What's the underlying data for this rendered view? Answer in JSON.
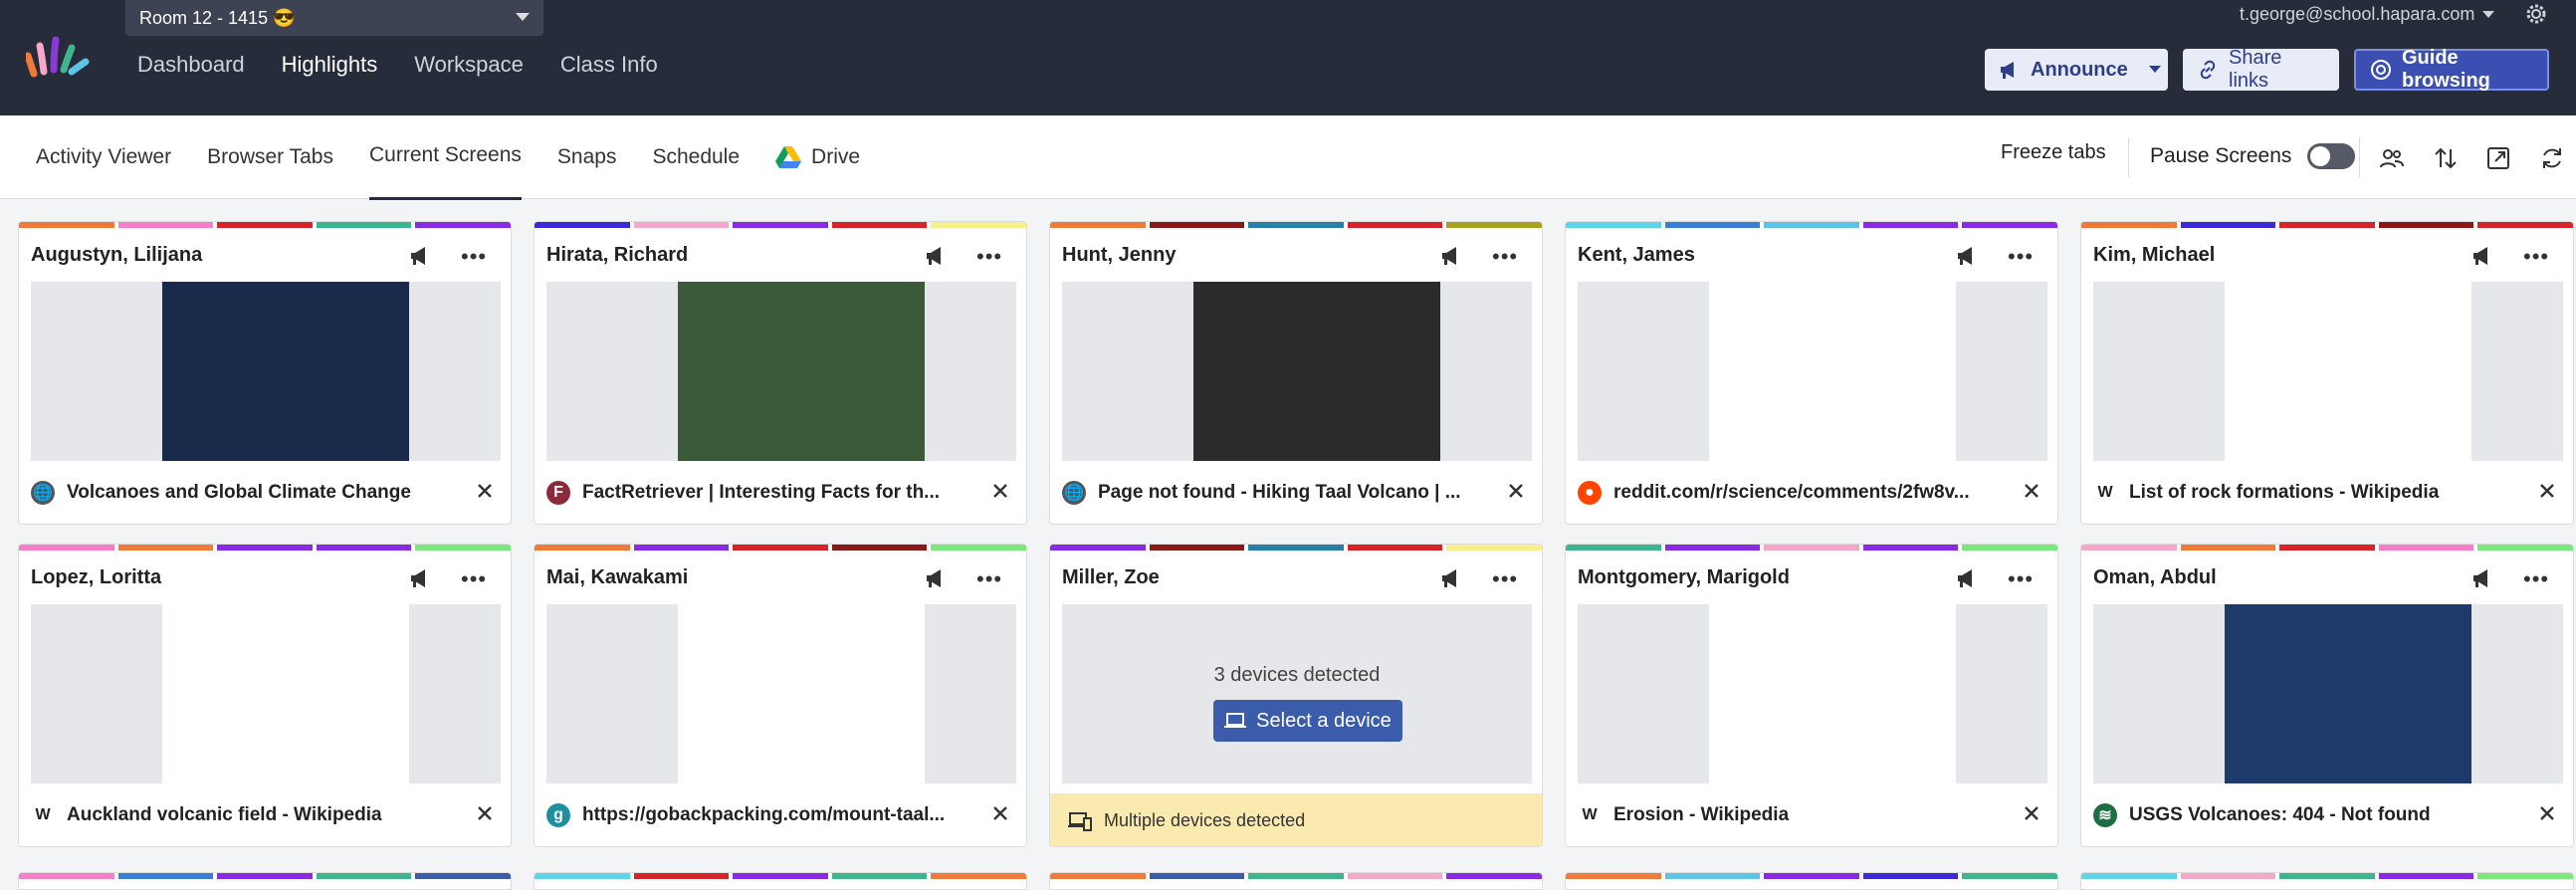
{
  "header": {
    "room": "Room 12 - 1415 😎",
    "nav": [
      "Dashboard",
      "Highlights",
      "Workspace",
      "Class Info"
    ],
    "active_nav": "Highlights",
    "account": "t.george@school.hapara.com",
    "buttons": {
      "announce": "Announce",
      "share": "Share links",
      "guide": "Guide browsing"
    }
  },
  "subtabs": {
    "items": [
      "Activity Viewer",
      "Browser Tabs",
      "Current Screens",
      "Snaps",
      "Schedule",
      "Drive"
    ],
    "active": "Current Screens",
    "freeze": "Freeze tabs",
    "pause": "Pause Screens"
  },
  "colors": {
    "accent": "#3b4fb3",
    "navbar": "#262c3a",
    "warning": "#fbeab0"
  },
  "students": [
    {
      "name": "Augustyn, Lilijana",
      "tab": "Volcanoes and Global Climate Change",
      "favicon": "globe-icon"
    },
    {
      "name": "Hirata, Richard",
      "tab": "FactRetriever | Interesting Facts for th...",
      "favicon": "factretriever-icon"
    },
    {
      "name": "Hunt, Jenny",
      "tab": "Page not found - Hiking Taal Volcano | ...",
      "favicon": "globe-icon"
    },
    {
      "name": "Kent, James",
      "tab": "reddit.com/r/science/comments/2fw8v...",
      "favicon": "reddit-icon"
    },
    {
      "name": "Kim, Michael",
      "tab": "List of rock formations - Wikipedia",
      "favicon": "wikipedia-icon"
    },
    {
      "name": "Lopez, Loritta",
      "tab": "Auckland volcanic field - Wikipedia",
      "favicon": "wikipedia-icon"
    },
    {
      "name": "Mai, Kawakami",
      "tab": "https://gobackpacking.com/mount-taal...",
      "favicon": "gobackpacking-icon"
    },
    {
      "name": "Miller, Zoe",
      "detected": "3 devices detected",
      "select": "Select a device",
      "multi": "Multiple devices detected"
    },
    {
      "name": "Montgomery, Marigold",
      "tab": "Erosion - Wikipedia",
      "favicon": "wikipedia-icon"
    },
    {
      "name": "Oman, Abdul",
      "tab": "USGS Volcanoes: 404 - Not found",
      "favicon": "usgs-icon"
    }
  ]
}
